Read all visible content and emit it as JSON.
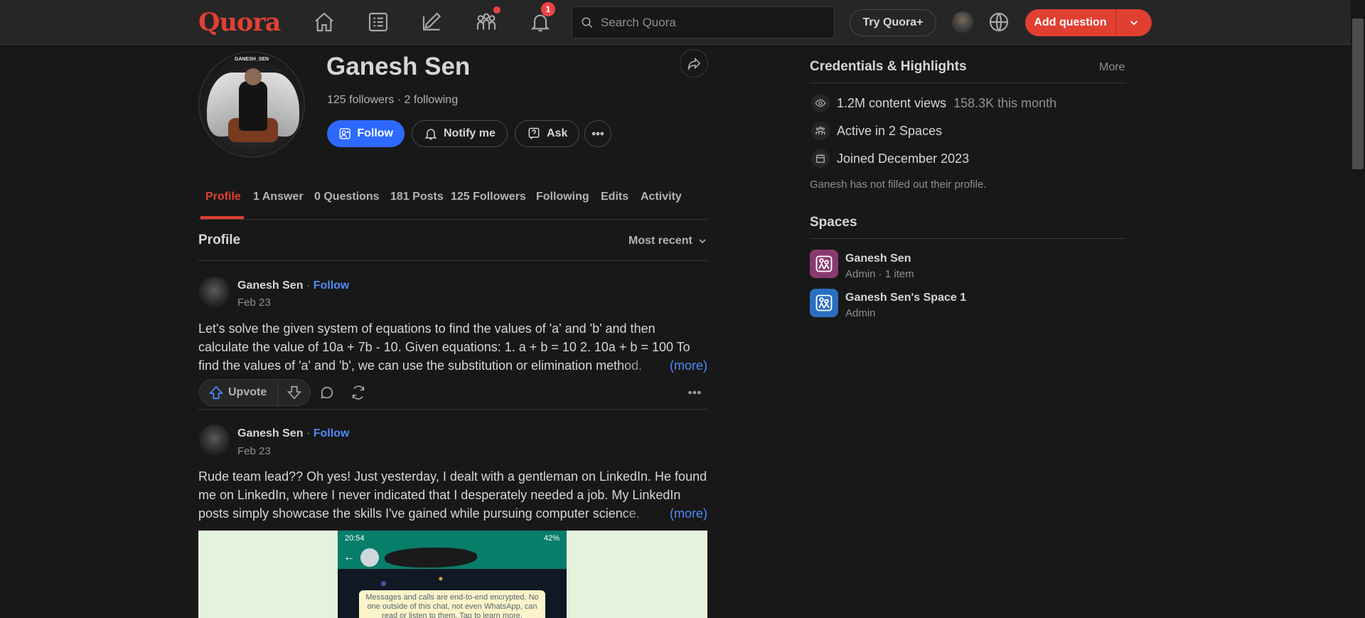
{
  "topbar": {
    "logo": "Quora",
    "notifications_count": "1",
    "search_placeholder": "Search Quora",
    "try_label": "Try Quora+",
    "add_question_label": "Add question"
  },
  "profile": {
    "name": "Ganesh Sen",
    "avatar_caption": "GANESH_SEN",
    "followers_following": "125 followers · 2 following",
    "follow_label": "Follow",
    "notify_label": "Notify me",
    "ask_label": "Ask"
  },
  "tabs": [
    {
      "label": "Profile"
    },
    {
      "label": "1 Answer"
    },
    {
      "label": "0 Questions"
    },
    {
      "label": "181 Posts"
    },
    {
      "label": "125 Followers"
    },
    {
      "label": "Following"
    },
    {
      "label": "Edits"
    },
    {
      "label": "Activity"
    }
  ],
  "feed": {
    "section_title": "Profile",
    "sort_label": "Most recent",
    "more_label": "(more)",
    "upvote_label": "Upvote",
    "posts": [
      {
        "author": "Ganesh Sen",
        "sep": "·",
        "follow": "Follow",
        "date": "Feb 23",
        "text": "Let's solve the given system of equations to find the values of 'a' and 'b' and then calculate the value of 10a + 7b - 10. Given equations: 1. a + b = 10 2. 10a + b = 100 To find the values of 'a' and 'b', we can use the substitution or elimination method."
      },
      {
        "author": "Ganesh Sen",
        "sep": "·",
        "follow": "Follow",
        "date": "Feb 23",
        "text": "Rude team lead?? Oh yes! Just yesterday, I dealt with a gentleman on LinkedIn. He found me on LinkedIn, where I never indicated that I desperately needed a job. My LinkedIn posts simply showcase the skills I've gained while pursuing computer science."
      }
    ],
    "screenshot": {
      "time": "20:54",
      "battery": "42%",
      "notice": "Messages and calls are end-to-end encrypted. No one outside of this chat, not even WhatsApp, can read or listen to them. Tap to learn more."
    }
  },
  "credentials": {
    "title": "Credentials & Highlights",
    "more": "More",
    "views_main": "1.2M content views",
    "views_sub": "158.3K this month",
    "spaces_active": "Active in 2 Spaces",
    "joined": "Joined December 2023",
    "no_profile": "Ganesh has not filled out their profile."
  },
  "spaces": {
    "title": "Spaces",
    "items": [
      {
        "name": "Ganesh Sen",
        "sub": "Admin · 1 item",
        "color": "#8a3a6e"
      },
      {
        "name": "Ganesh Sen's Space 1",
        "sub": "Admin",
        "color": "#2a6fbf"
      }
    ]
  },
  "colors": {
    "brand": "#e13f32",
    "link": "#4e8cf6",
    "follow_button": "#2e69ff"
  }
}
